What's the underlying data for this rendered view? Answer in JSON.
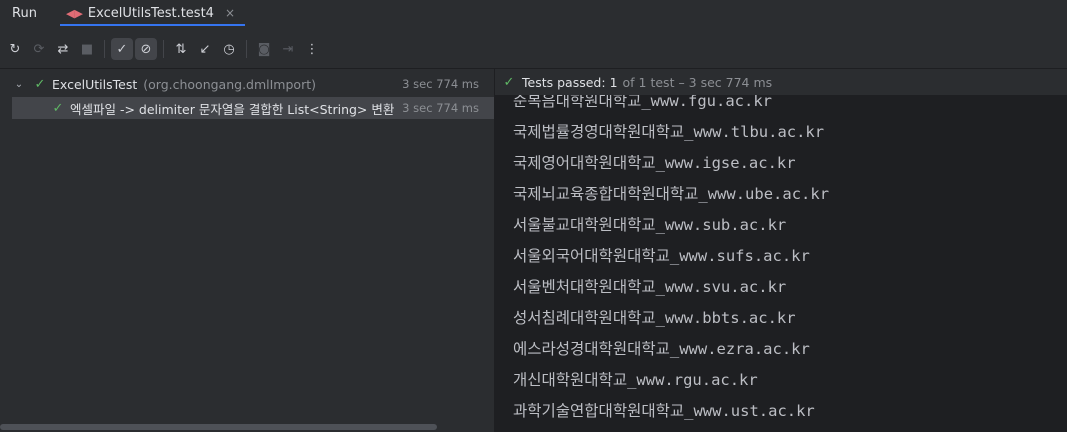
{
  "tabbar": {
    "run_label": "Run",
    "tab_label": "ExcelUtilsTest.test4",
    "tab_close": "×"
  },
  "toolbar": {
    "buttons": [
      {
        "name": "rerun-icon",
        "glyph": "↻",
        "active": false,
        "disabled": false
      },
      {
        "name": "rerun-failed-icon",
        "glyph": "⟳",
        "active": false,
        "disabled": true
      },
      {
        "name": "toggle-auto-test-icon",
        "glyph": "⇄",
        "active": false,
        "disabled": false
      },
      {
        "name": "stop-icon",
        "glyph": "■",
        "active": false,
        "disabled": true
      },
      {
        "name": "show-passed-icon",
        "glyph": "✓",
        "active": true,
        "disabled": false
      },
      {
        "name": "show-ignored-icon",
        "glyph": "⊘",
        "active": true,
        "disabled": false
      },
      {
        "name": "sort-icon",
        "glyph": "⇅",
        "active": false,
        "disabled": false
      },
      {
        "name": "collapse-icon",
        "glyph": "↙",
        "active": false,
        "disabled": false
      },
      {
        "name": "history-icon",
        "glyph": "◷",
        "active": false,
        "disabled": false
      },
      {
        "name": "camera-icon",
        "glyph": "◙",
        "active": false,
        "disabled": true
      },
      {
        "name": "import-icon",
        "glyph": "⇥",
        "active": false,
        "disabled": true
      },
      {
        "name": "more-icon",
        "glyph": "⋮",
        "active": false,
        "disabled": false
      }
    ]
  },
  "tree": {
    "root": {
      "name": "ExcelUtilsTest",
      "package": "(org.choongang.dmlImport)",
      "duration": "3 sec 774 ms"
    },
    "child": {
      "name": "엑셀파일 -> delimiter 문자열을 결합한 List<String> 변환",
      "duration": "3 sec 774 ms"
    }
  },
  "status": {
    "label": "Tests passed:",
    "count": "1",
    "detail": "of 1 test – 3 sec 774 ms"
  },
  "console": {
    "lines": [
      "순복음대학원대학교_www.fgu.ac.kr",
      "국제법률경영대학원대학교_www.tlbu.ac.kr",
      "국제영어대학원대학교_www.igse.ac.kr",
      "국제뇌교육종합대학원대학교_www.ube.ac.kr",
      "서울불교대학원대학교_www.sub.ac.kr",
      "서울외국어대학원대학교_www.sufs.ac.kr",
      "서울벤처대학원대학교_www.svu.ac.kr",
      "성서침례대학원대학교_www.bbts.ac.kr",
      "에스라성경대학원대학교_www.ezra.ac.kr",
      "개신대학원대학교_www.rgu.ac.kr",
      "과학기술연합대학원대학교_www.ust.ac.kr"
    ]
  },
  "colors": {
    "background": "#2b2d30",
    "console_background": "#1e1f22",
    "pass_green": "#5fb865",
    "accent": "#3574f0"
  }
}
